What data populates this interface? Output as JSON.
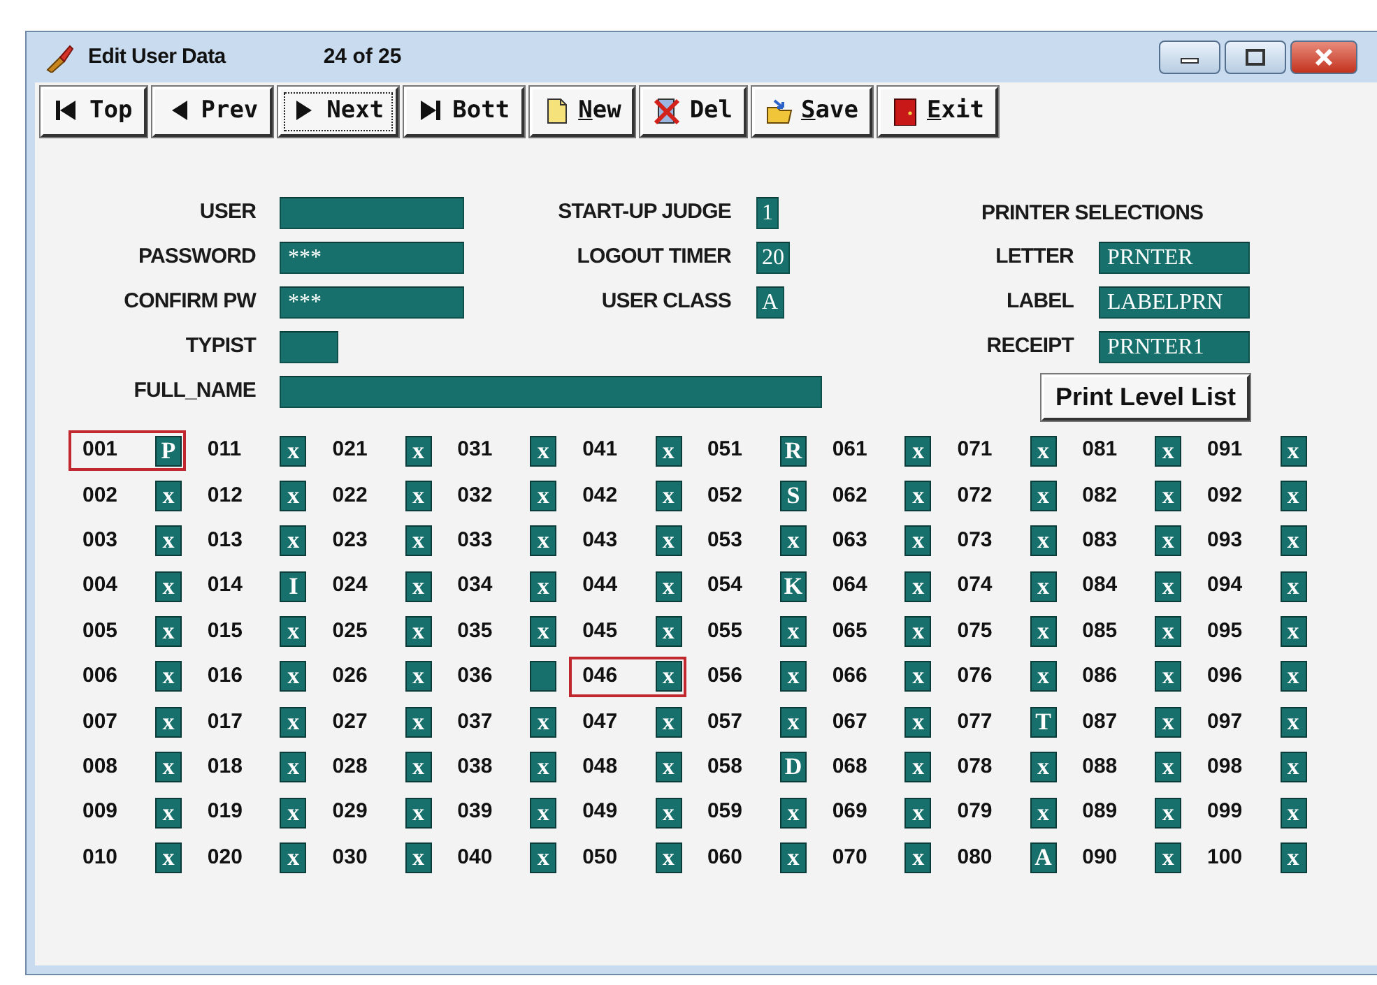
{
  "window": {
    "title": "Edit User Data",
    "record_counter": "24 of 25"
  },
  "toolbar": [
    {
      "kind": "first",
      "label": "Top",
      "focused": false,
      "mnemonic": false
    },
    {
      "kind": "prev",
      "label": "Prev",
      "focused": false,
      "mnemonic": false
    },
    {
      "kind": "next",
      "label": "Next",
      "focused": true,
      "mnemonic": false
    },
    {
      "kind": "last",
      "label": "Bott",
      "focused": false,
      "mnemonic": false
    },
    {
      "kind": "new",
      "label": "New",
      "focused": false,
      "mnemonic": true
    },
    {
      "kind": "delete",
      "label": "Del",
      "focused": false,
      "mnemonic": false
    },
    {
      "kind": "save",
      "label": "Save",
      "focused": false,
      "mnemonic": true
    },
    {
      "kind": "exit",
      "label": "Exit",
      "focused": false,
      "mnemonic": true
    }
  ],
  "user_fields": [
    {
      "label": "USER",
      "kind": "medium"
    },
    {
      "label": "PASSWORD",
      "value": "***",
      "kind": "medium"
    },
    {
      "label": "CONFIRM PW",
      "value": "***",
      "kind": "medium"
    },
    {
      "label": "TYPIST",
      "kind": "short"
    },
    {
      "label": "FULL_NAME",
      "kind": "long"
    }
  ],
  "settings": [
    {
      "label": "START-UP JUDGE",
      "value": "1"
    },
    {
      "label": "LOGOUT TIMER",
      "value": "20"
    },
    {
      "label": "USER CLASS",
      "value": "A"
    }
  ],
  "printer_selections": {
    "title": "PRINTER SELECTIONS",
    "fields": [
      {
        "label": "LETTER",
        "value": "PRNTER"
      },
      {
        "label": "LABEL",
        "value": "LABELPRN"
      },
      {
        "label": "RECEIPT",
        "value": "PRNTER1"
      }
    ],
    "button": "Print Level List"
  },
  "levels": [
    {
      "code": "001",
      "value": "P",
      "selected": true
    },
    {
      "code": "002",
      "value": "x",
      "selected": false
    },
    {
      "code": "003",
      "value": "x",
      "selected": false
    },
    {
      "code": "004",
      "value": "x",
      "selected": false
    },
    {
      "code": "005",
      "value": "x",
      "selected": false
    },
    {
      "code": "006",
      "value": "x",
      "selected": false
    },
    {
      "code": "007",
      "value": "x",
      "selected": false
    },
    {
      "code": "008",
      "value": "x",
      "selected": false
    },
    {
      "code": "009",
      "value": "x",
      "selected": false
    },
    {
      "code": "010",
      "value": "x",
      "selected": false
    },
    {
      "code": "011",
      "value": "x",
      "selected": false
    },
    {
      "code": "012",
      "value": "x",
      "selected": false
    },
    {
      "code": "013",
      "value": "x",
      "selected": false
    },
    {
      "code": "014",
      "value": "I",
      "selected": false
    },
    {
      "code": "015",
      "value": "x",
      "selected": false
    },
    {
      "code": "016",
      "value": "x",
      "selected": false
    },
    {
      "code": "017",
      "value": "x",
      "selected": false
    },
    {
      "code": "018",
      "value": "x",
      "selected": false
    },
    {
      "code": "019",
      "value": "x",
      "selected": false
    },
    {
      "code": "020",
      "value": "x",
      "selected": false
    },
    {
      "code": "021",
      "value": "x",
      "selected": false
    },
    {
      "code": "022",
      "value": "x",
      "selected": false
    },
    {
      "code": "023",
      "value": "x",
      "selected": false
    },
    {
      "code": "024",
      "value": "x",
      "selected": false
    },
    {
      "code": "025",
      "value": "x",
      "selected": false
    },
    {
      "code": "026",
      "value": "x",
      "selected": false
    },
    {
      "code": "027",
      "value": "x",
      "selected": false
    },
    {
      "code": "028",
      "value": "x",
      "selected": false
    },
    {
      "code": "029",
      "value": "x",
      "selected": false
    },
    {
      "code": "030",
      "value": "x",
      "selected": false
    },
    {
      "code": "031",
      "value": "x",
      "selected": false
    },
    {
      "code": "032",
      "value": "x",
      "selected": false
    },
    {
      "code": "033",
      "value": "x",
      "selected": false
    },
    {
      "code": "034",
      "value": "x",
      "selected": false
    },
    {
      "code": "035",
      "value": "x",
      "selected": false
    },
    {
      "code": "036",
      "selected": false
    },
    {
      "code": "037",
      "value": "x",
      "selected": false
    },
    {
      "code": "038",
      "value": "x",
      "selected": false
    },
    {
      "code": "039",
      "value": "x",
      "selected": false
    },
    {
      "code": "040",
      "value": "x",
      "selected": false
    },
    {
      "code": "041",
      "value": "x",
      "selected": false
    },
    {
      "code": "042",
      "value": "x",
      "selected": false
    },
    {
      "code": "043",
      "value": "x",
      "selected": false
    },
    {
      "code": "044",
      "value": "x",
      "selected": false
    },
    {
      "code": "045",
      "value": "x",
      "selected": false
    },
    {
      "code": "046",
      "value": "x",
      "selected": true
    },
    {
      "code": "047",
      "value": "x",
      "selected": false
    },
    {
      "code": "048",
      "value": "x",
      "selected": false
    },
    {
      "code": "049",
      "value": "x",
      "selected": false
    },
    {
      "code": "050",
      "value": "x",
      "selected": false
    },
    {
      "code": "051",
      "value": "R",
      "selected": false
    },
    {
      "code": "052",
      "value": "S",
      "selected": false
    },
    {
      "code": "053",
      "value": "x",
      "selected": false
    },
    {
      "code": "054",
      "value": "K",
      "selected": false
    },
    {
      "code": "055",
      "value": "x",
      "selected": false
    },
    {
      "code": "056",
      "value": "x",
      "selected": false
    },
    {
      "code": "057",
      "value": "x",
      "selected": false
    },
    {
      "code": "058",
      "value": "D",
      "selected": false
    },
    {
      "code": "059",
      "value": "x",
      "selected": false
    },
    {
      "code": "060",
      "value": "x",
      "selected": false
    },
    {
      "code": "061",
      "value": "x",
      "selected": false
    },
    {
      "code": "062",
      "value": "x",
      "selected": false
    },
    {
      "code": "063",
      "value": "x",
      "selected": false
    },
    {
      "code": "064",
      "value": "x",
      "selected": false
    },
    {
      "code": "065",
      "value": "x",
      "selected": false
    },
    {
      "code": "066",
      "value": "x",
      "selected": false
    },
    {
      "code": "067",
      "value": "x",
      "selected": false
    },
    {
      "code": "068",
      "value": "x",
      "selected": false
    },
    {
      "code": "069",
      "value": "x",
      "selected": false
    },
    {
      "code": "070",
      "value": "x",
      "selected": false
    },
    {
      "code": "071",
      "value": "x",
      "selected": false
    },
    {
      "code": "072",
      "value": "x",
      "selected": false
    },
    {
      "code": "073",
      "value": "x",
      "selected": false
    },
    {
      "code": "074",
      "value": "x",
      "selected": false
    },
    {
      "code": "075",
      "value": "x",
      "selected": false
    },
    {
      "code": "076",
      "value": "x",
      "selected": false
    },
    {
      "code": "077",
      "value": "T",
      "selected": false
    },
    {
      "code": "078",
      "value": "x",
      "selected": false
    },
    {
      "code": "079",
      "value": "x",
      "selected": false
    },
    {
      "code": "080",
      "value": "A",
      "selected": false
    },
    {
      "code": "081",
      "value": "x",
      "selected": false
    },
    {
      "code": "082",
      "value": "x",
      "selected": false
    },
    {
      "code": "083",
      "value": "x",
      "selected": false
    },
    {
      "code": "084",
      "value": "x",
      "selected": false
    },
    {
      "code": "085",
      "value": "x",
      "selected": false
    },
    {
      "code": "086",
      "value": "x",
      "selected": false
    },
    {
      "code": "087",
      "value": "x",
      "selected": false
    },
    {
      "code": "088",
      "value": "x",
      "selected": false
    },
    {
      "code": "089",
      "value": "x",
      "selected": false
    },
    {
      "code": "090",
      "value": "x",
      "selected": false
    },
    {
      "code": "091",
      "value": "x",
      "selected": false
    },
    {
      "code": "092",
      "value": "x",
      "selected": false
    },
    {
      "code": "093",
      "value": "x",
      "selected": false
    },
    {
      "code": "094",
      "value": "x",
      "selected": false
    },
    {
      "code": "095",
      "value": "x",
      "selected": false
    },
    {
      "code": "096",
      "value": "x",
      "selected": false
    },
    {
      "code": "097",
      "value": "x",
      "selected": false
    },
    {
      "code": "098",
      "value": "x",
      "selected": false
    },
    {
      "code": "099",
      "value": "x",
      "selected": false
    },
    {
      "code": "100",
      "value": "x",
      "selected": false
    }
  ]
}
